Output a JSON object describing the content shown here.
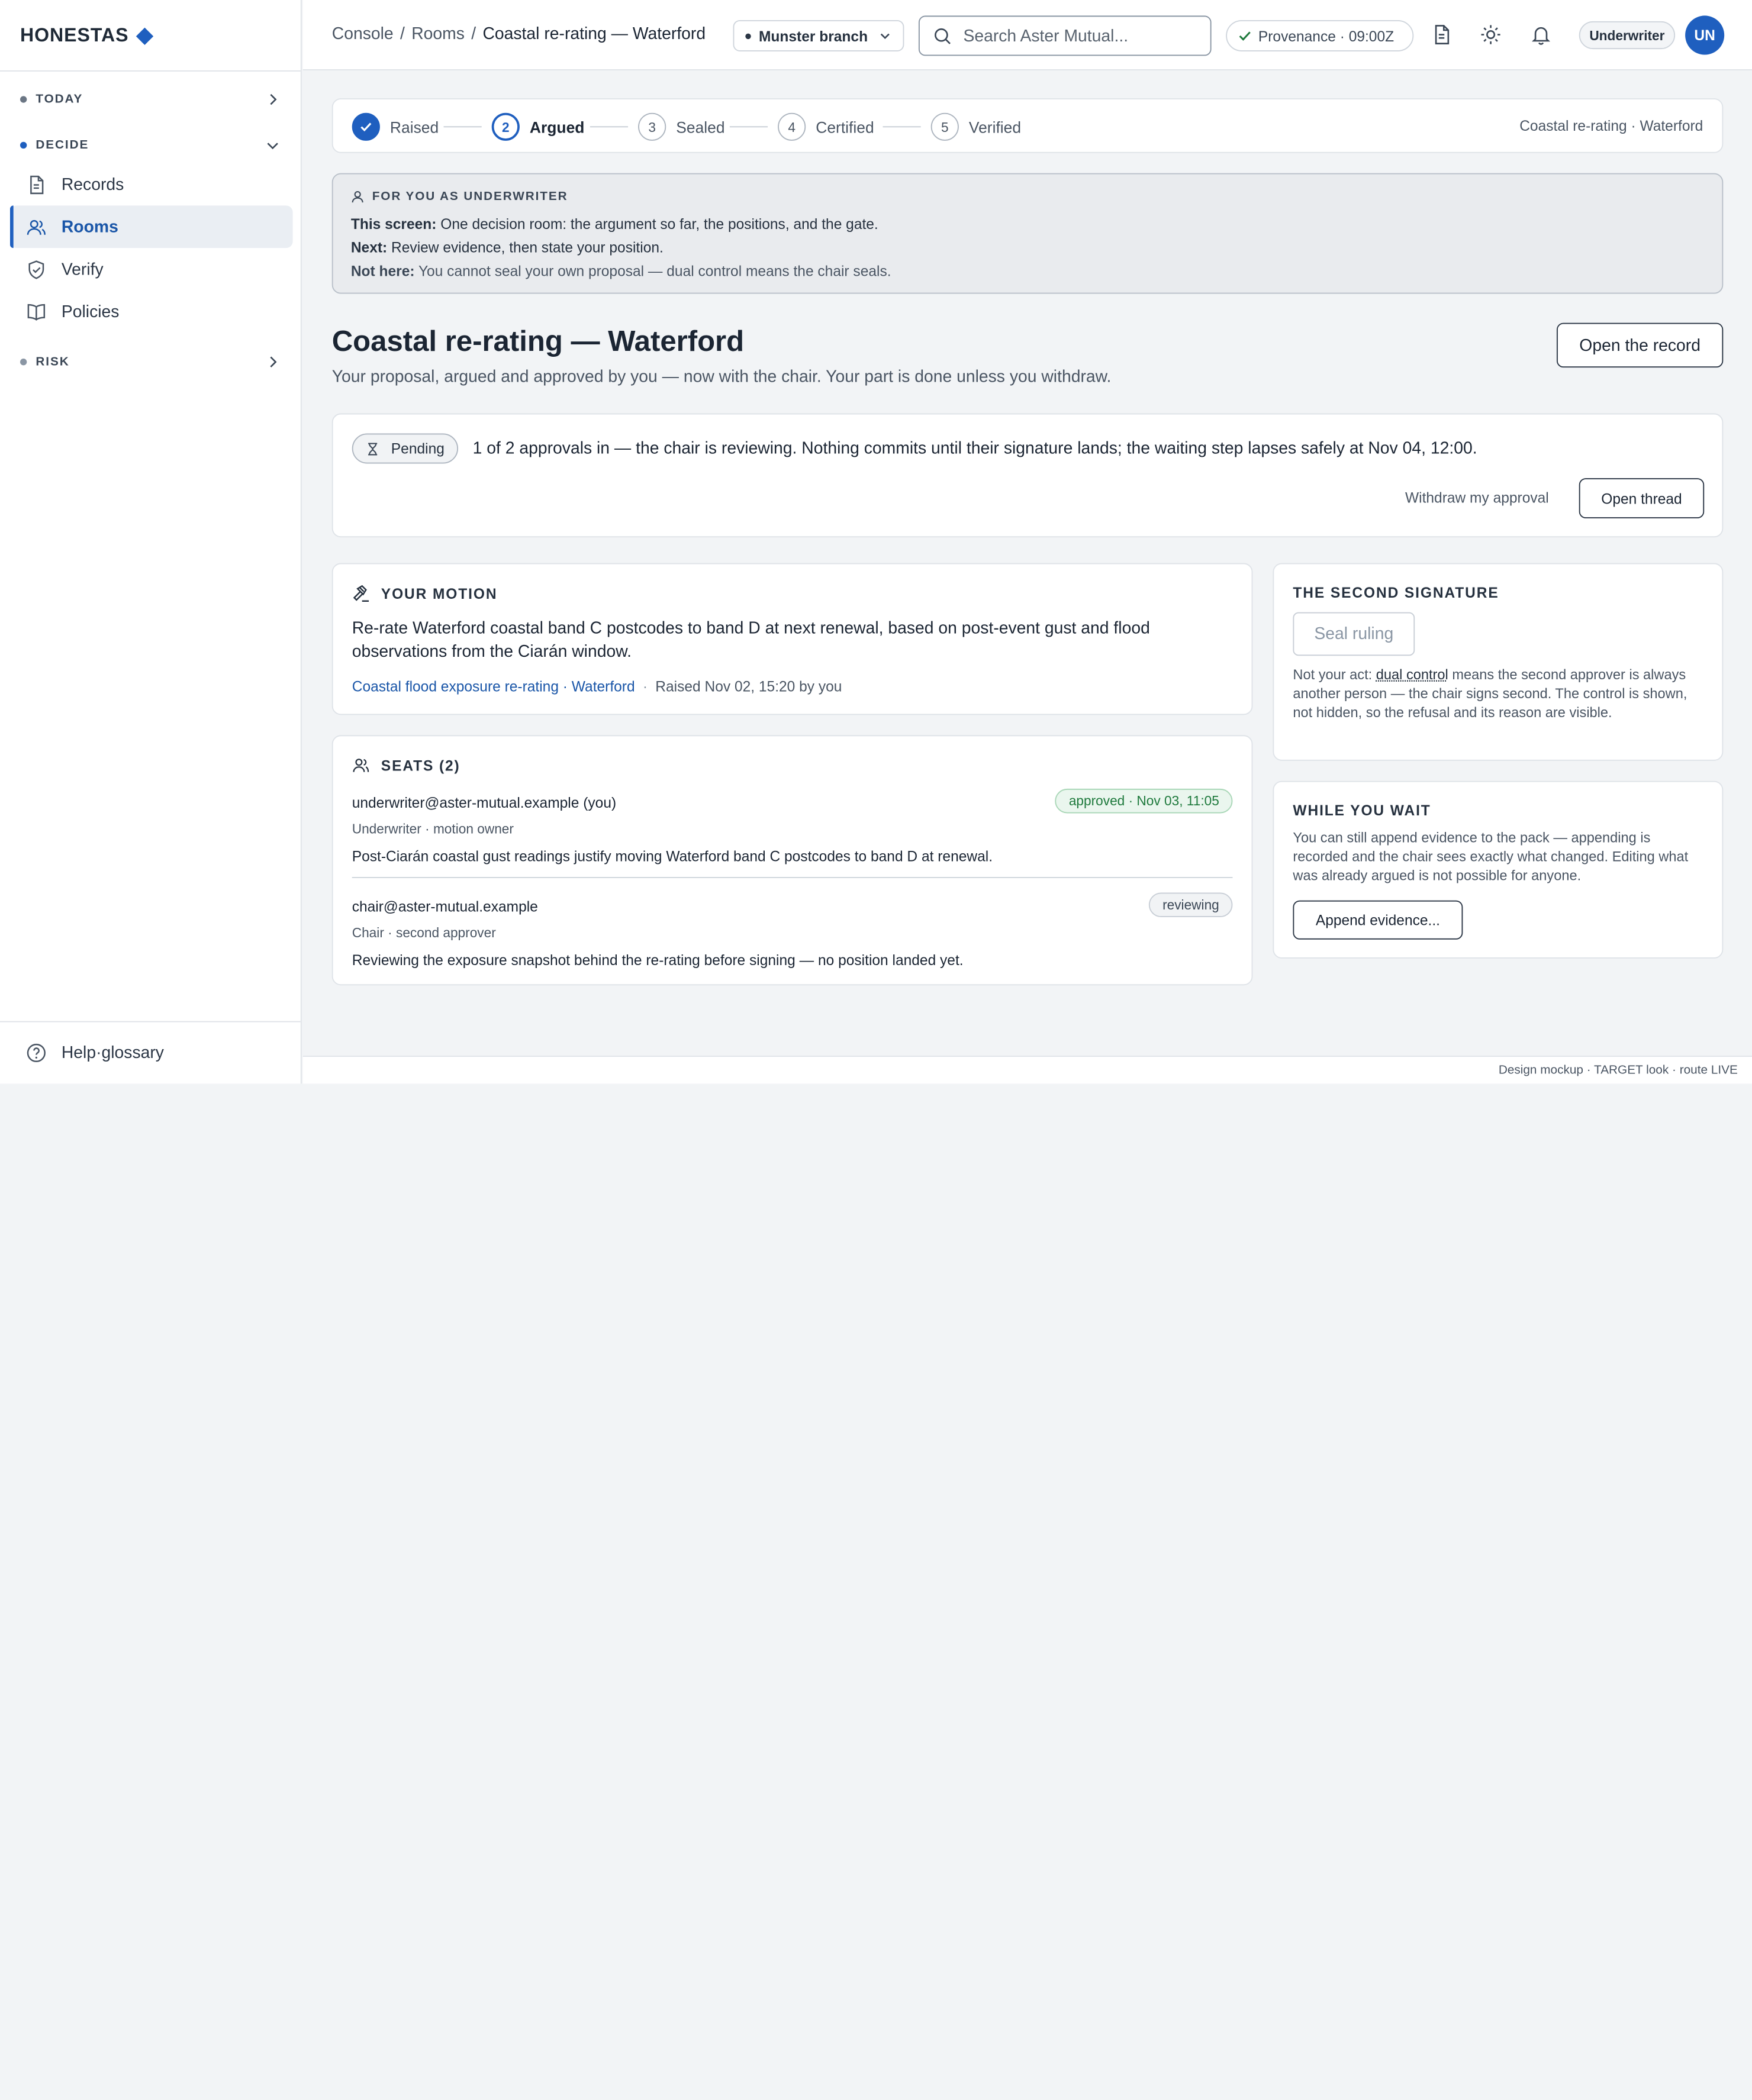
{
  "brand": {
    "name": "HONESTAS"
  },
  "sidebar": {
    "groups": [
      {
        "label": "TODAY",
        "dot_color": "#6b7684"
      },
      {
        "label": "DECIDE",
        "dot_color": "#1f5fbf"
      },
      {
        "label": "RISK",
        "dot_color": "#8a96a4"
      }
    ],
    "items": [
      {
        "label": "Records",
        "icon": "document-icon"
      },
      {
        "label": "Rooms",
        "icon": "users-icon",
        "active": true
      },
      {
        "label": "Verify",
        "icon": "shield-check-icon"
      },
      {
        "label": "Policies",
        "icon": "book-icon"
      }
    ],
    "footer": {
      "label": "Help·glossary",
      "icon": "help-circle-icon"
    }
  },
  "topbar": {
    "breadcrumb": [
      "Console",
      "Rooms",
      "Coastal re-rating — Waterford"
    ],
    "breadcrumb_sep": "/",
    "branch": "Munster branch",
    "search_placeholder": "Search Aster Mutual...",
    "provenance": "Provenance · 09:00Z",
    "role": "Underwriter",
    "avatar_initials": "UN"
  },
  "steps": {
    "items": [
      {
        "n": "1",
        "label": "Raised",
        "state": "done"
      },
      {
        "n": "2",
        "label": "Argued",
        "state": "current"
      },
      {
        "n": "3",
        "label": "Sealed",
        "state": "todo"
      },
      {
        "n": "4",
        "label": "Certified",
        "state": "todo"
      },
      {
        "n": "5",
        "label": "Verified",
        "state": "todo"
      }
    ],
    "context": "Coastal re-rating · Waterford"
  },
  "guidance": {
    "heading": "FOR YOU AS UNDERWRITER",
    "this_label": "This screen:",
    "this_text": " One decision room: the argument so far, the positions, and the gate.",
    "next_label": "Next:",
    "next_text": " Review evidence, then state your position.",
    "not_label": "Not here:",
    "not_text": " You cannot seal your own proposal — dual control means the chair seals."
  },
  "page": {
    "title": "Coastal re-rating — Waterford",
    "subtitle": "Your proposal, argued and approved by you — now with the chair. Your part is done unless you withdraw.",
    "open_record": "Open the record"
  },
  "status": {
    "pill": "Pending",
    "message": "1 of 2 approvals in — the chair is reviewing. Nothing commits until their signature lands; the waiting step lapses safely at Nov 04, 12:00.",
    "withdraw": "Withdraw my approval",
    "open_thread": "Open thread"
  },
  "motion": {
    "heading": "YOUR MOTION",
    "text": "Re-rate Waterford coastal band C postcodes to band D at next renewal, based on post-event gust and flood observations from the Ciarán window.",
    "link": "Coastal flood exposure re-rating · Waterford",
    "sep": "·",
    "raised": "Raised Nov 02, 15:20 by you"
  },
  "seats": {
    "heading": "SEATS (2)",
    "list": [
      {
        "who": "underwriter@aster-mutual.example (you)",
        "role": "Underwriter · motion owner",
        "badge": "approved · Nov 03, 11:05",
        "badge_kind": "approved",
        "text": "Post-Ciarán coastal gust readings justify moving Waterford band C postcodes to band D at renewal."
      },
      {
        "who": "chair@aster-mutual.example",
        "role": "Chair · second approver",
        "badge": "reviewing",
        "badge_kind": "reviewing",
        "text": "Reviewing the exposure snapshot behind the re-rating before signing — no position landed yet."
      }
    ]
  },
  "second_signature": {
    "heading": "THE SECOND SIGNATURE",
    "button": "Seal ruling",
    "desc_before": "Not your act: ",
    "desc_term": "dual control",
    "desc_after": " means the second approver is always another person — the chair signs second. The control is shown, not hidden, so the refusal and its reason are visible."
  },
  "while_wait": {
    "heading": "WHILE YOU WAIT",
    "desc": "You can still append evidence to the pack — appending is recorded and the chair sees exactly what changed. Editing what was already argued is not possible for anyone.",
    "button": "Append evidence..."
  },
  "footer": {
    "text": "Design mockup · TARGET look · route LIVE"
  },
  "colors": {
    "accent": "#1f5fbf",
    "approved": "#1f7a3d"
  }
}
